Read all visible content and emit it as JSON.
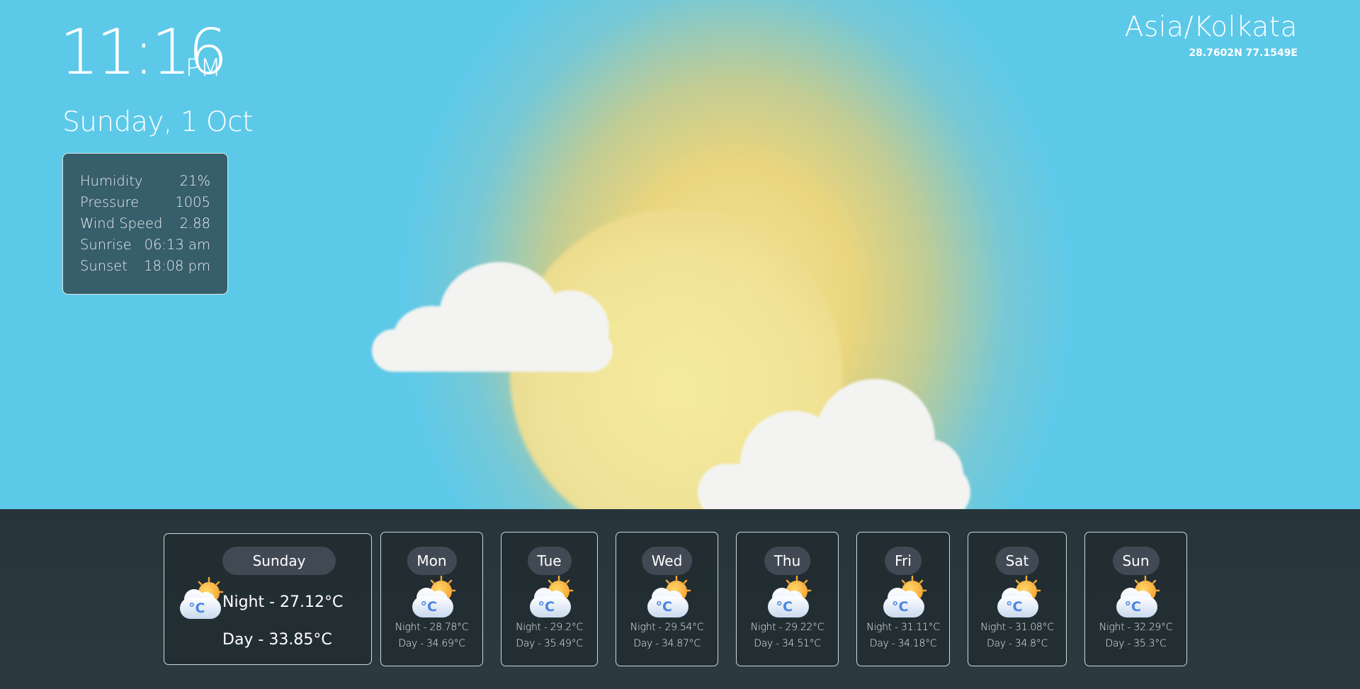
{
  "clock": {
    "time": "11:16",
    "ampm": "PM"
  },
  "date": "Sunday, 1 Oct",
  "details": [
    {
      "label": "Humidity",
      "value": "21%"
    },
    {
      "label": "Pressure",
      "value": "1005"
    },
    {
      "label": "Wind Speed",
      "value": "2.88"
    },
    {
      "label": "Sunrise",
      "value": "06:13 am"
    },
    {
      "label": "Sunset",
      "value": "18:08 pm"
    }
  ],
  "location": {
    "timezone": "Asia/Kolkata",
    "coords": "28.7602N 77.1549E"
  },
  "weather_icon": "sun-behind-cloud-icon",
  "degree_symbol": "°C",
  "today": {
    "day": "Sunday",
    "night": "Night - 27.12°C",
    "day_temp": "Day - 33.85°C"
  },
  "forecast": [
    {
      "day": "Mon",
      "night": "Night - 28.78°C",
      "day_temp": "Day - 34.69°C"
    },
    {
      "day": "Tue",
      "night": "Night - 29.2°C",
      "day_temp": "Day - 35.49°C"
    },
    {
      "day": "Wed",
      "night": "Night - 29.54°C",
      "day_temp": "Day - 34.87°C"
    },
    {
      "day": "Thu",
      "night": "Night - 29.22°C",
      "day_temp": "Day - 34.51°C"
    },
    {
      "day": "Fri",
      "night": "Night - 31.11°C",
      "day_temp": "Day - 34.18°C"
    },
    {
      "day": "Sat",
      "night": "Night - 31.08°C",
      "day_temp": "Day - 34.8°C"
    },
    {
      "day": "Sun",
      "night": "Night - 32.29°C",
      "day_temp": "Day - 35.3°C"
    }
  ]
}
